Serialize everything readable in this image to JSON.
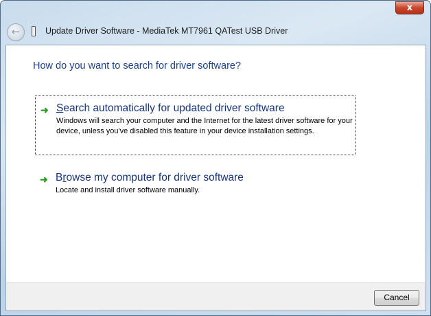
{
  "window": {
    "title": "Update Driver Software - MediaTek MT7961 QATest USB Driver",
    "close_label": "x",
    "back_icon": "back-arrow-icon",
    "device_icon": "usb-device-icon"
  },
  "main": {
    "heading": "How do you want to search for driver software?",
    "options": [
      {
        "accel": "S",
        "title_rest": "earch automatically for updated driver software",
        "title_pre": "",
        "description": "Windows will search your computer and the Internet for the latest driver software for your device, unless you've disabled this feature in your device installation settings."
      },
      {
        "title_pre": "B",
        "accel": "r",
        "title_rest": "owse my computer for driver software",
        "description": "Locate and install driver software manually."
      }
    ]
  },
  "footer": {
    "cancel_label": "Cancel"
  },
  "colors": {
    "heading": "#1a3e8a",
    "arrow": "#2e9c2a"
  }
}
